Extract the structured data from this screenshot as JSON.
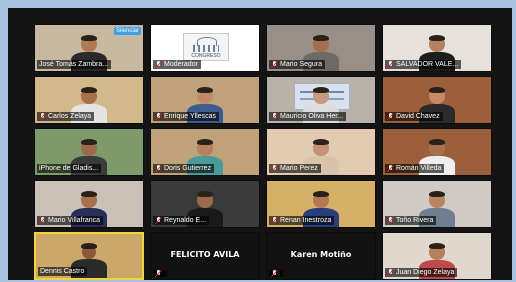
{
  "meeting": {
    "badge": "Silenciar",
    "congreso_logo_text": "CONGRESO",
    "tiles": [
      {
        "label": "José Tomás Zambra...",
        "muted": false,
        "type": "video",
        "wall": "#c9b8a0",
        "skin": "#b07a55",
        "shirt": "#2a2a2a",
        "badge": true
      },
      {
        "label": "Moderador",
        "muted": true,
        "type": "logo",
        "wall": "#ffffff"
      },
      {
        "label": "Mario Segura",
        "muted": true,
        "type": "video",
        "wall": "#9a8f86",
        "skin": "#a2704e",
        "shirt": "#6e6b66"
      },
      {
        "label": "SALVADOR VALE...",
        "muted": true,
        "type": "video",
        "wall": "#e7e3dc",
        "skin": "#b78060",
        "shirt": "#1d1d1d"
      },
      {
        "label": "Carlos Zelaya",
        "muted": true,
        "type": "video",
        "wall": "#d1b98c",
        "skin": "#a9704b",
        "shirt": "#e4e4e4"
      },
      {
        "label": "Enrique Yllescas",
        "muted": true,
        "type": "video",
        "wall": "#bfa27a",
        "skin": "#c08a67",
        "shirt": "#3e5d8f"
      },
      {
        "label": "Mauricio Oliva Her...",
        "muted": true,
        "type": "poster",
        "wall": "#b8b2a9",
        "skin": "#c69a7a",
        "shirt": "#dcdcdc"
      },
      {
        "label": "David Chavez",
        "muted": true,
        "type": "video",
        "wall": "#9b5f3c",
        "skin": "#c98a63",
        "shirt": "#2b2b2b"
      },
      {
        "label": "iPhone de Gladis...",
        "muted": false,
        "type": "video",
        "wall": "#7f9a6a",
        "skin": "#9a6a4a",
        "shirt": "#3a3a3a"
      },
      {
        "label": "Doris Gutierrez",
        "muted": true,
        "type": "video",
        "wall": "#bfa27a",
        "skin": "#b5805c",
        "shirt": "#4a9a9a"
      },
      {
        "label": "Mario Perez",
        "muted": true,
        "type": "video",
        "wall": "#e2cbb0",
        "skin": "#c59272",
        "shirt": "#d8c3aa"
      },
      {
        "label": "Román Villeda",
        "muted": true,
        "type": "video",
        "wall": "#9b5f3c",
        "skin": "#a8704c",
        "shirt": "#eeeeee"
      },
      {
        "label": "Mario Villafranca",
        "muted": true,
        "type": "video",
        "wall": "#c9c1b6",
        "skin": "#a8724e",
        "shirt": "#28305a"
      },
      {
        "label": "Reynaldo E...",
        "muted": true,
        "type": "video",
        "wall": "#3a3a3a",
        "skin": "#9a6a4a",
        "shirt": "#1a1a1a"
      },
      {
        "label": "Renan Inestroza",
        "muted": true,
        "type": "video",
        "wall": "#d7b068",
        "skin": "#b07a55",
        "shirt": "#2a3f7a"
      },
      {
        "label": "Toño Rivera",
        "muted": true,
        "type": "video",
        "wall": "#cfcbc4",
        "skin": "#b98462",
        "shirt": "#6e7f92"
      },
      {
        "label": "Dennis Castro",
        "muted": false,
        "type": "video",
        "wall": "#caa86a",
        "skin": "#8a5a3a",
        "shirt": "#2a2a2a",
        "speaking": true
      },
      {
        "label": "",
        "muted": true,
        "type": "name",
        "bigname": "FELICITO AVILA"
      },
      {
        "label": "",
        "muted": true,
        "type": "name",
        "bigname": "Karen Motiño"
      },
      {
        "label": "Juan Diego Zelaya",
        "muted": true,
        "type": "video",
        "wall": "#e0d8cc",
        "skin": "#b58060",
        "shirt": "#c04a4a"
      }
    ]
  }
}
